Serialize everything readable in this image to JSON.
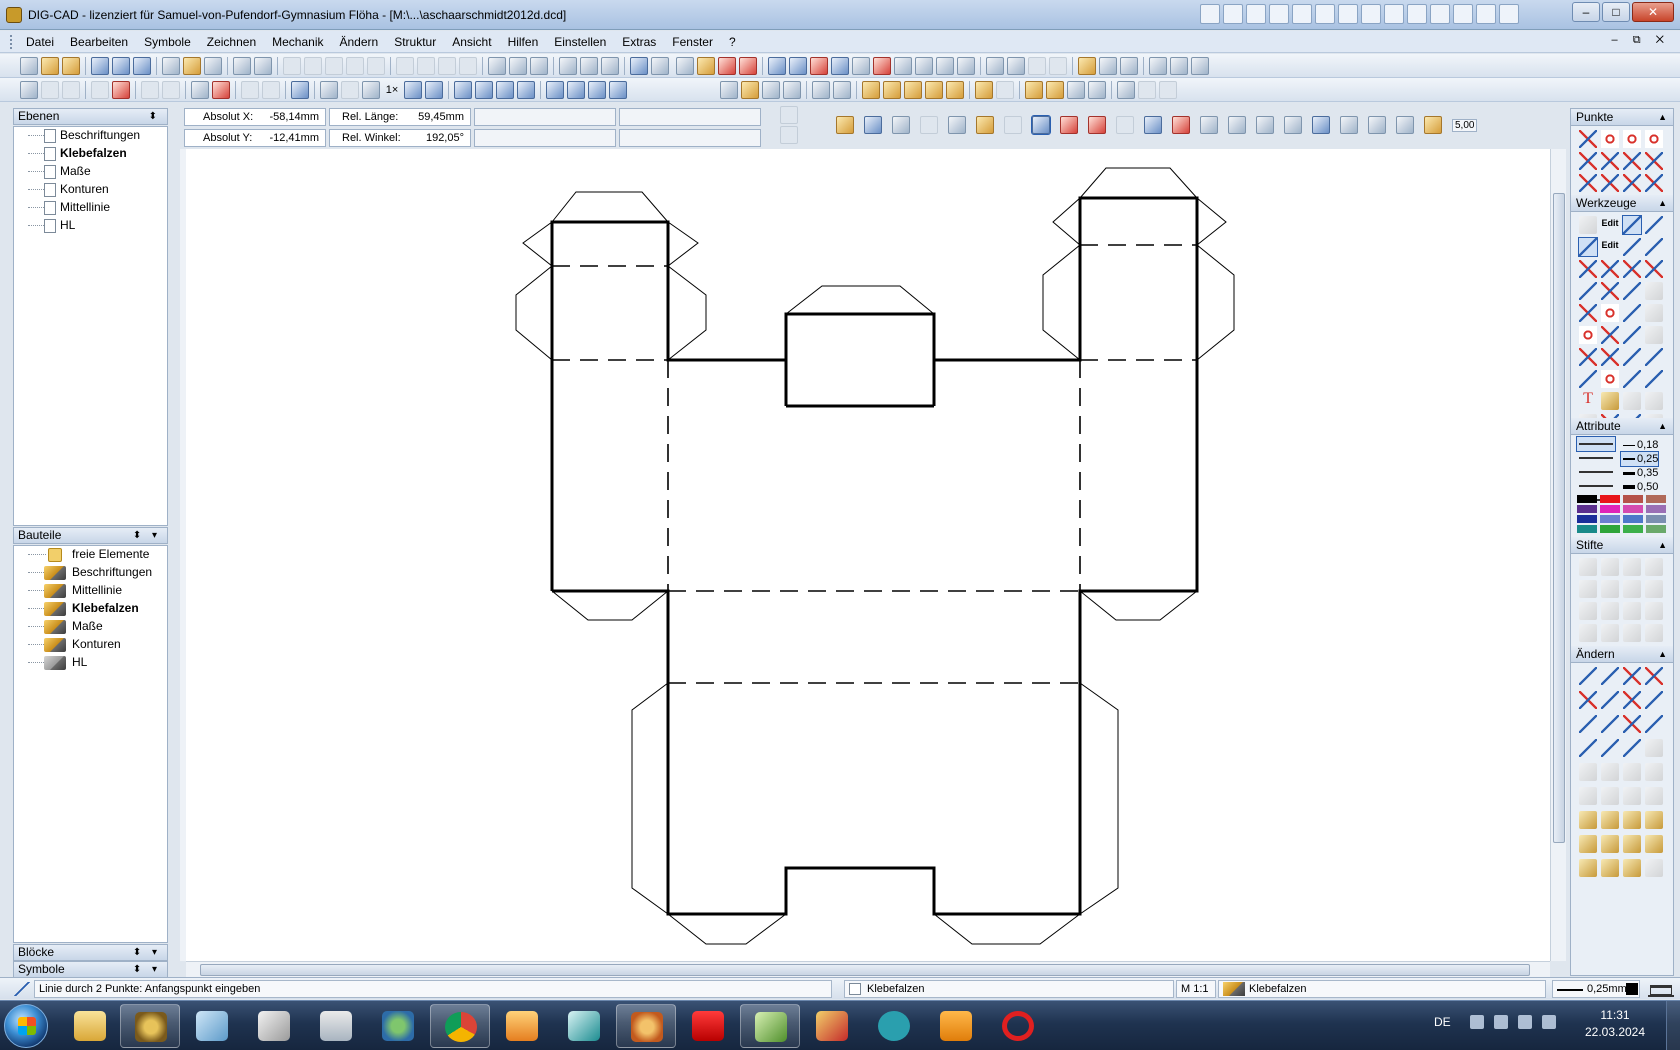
{
  "window": {
    "title": "DIG-CAD - lizenziert für Samuel-von-Pufendorf-Gymnasium Flöha - [M:\\...\\aschaarschmidt2012d.dcd]",
    "min": "–",
    "max": "□",
    "close": "✕"
  },
  "menu": [
    "Datei",
    "Bearbeiten",
    "Symbole",
    "Zeichnen",
    "Mechanik",
    "Ändern",
    "Struktur",
    "Ansicht",
    "Hilfen",
    "Einstellen",
    "Extras",
    "Fenster",
    "?"
  ],
  "mdi_controls": "– ⧉ ✕",
  "coords": {
    "abs_x_label": "Absolut X:",
    "abs_x_value": "-58,14mm",
    "abs_y_label": "Absolut Y:",
    "abs_y_value": "-12,41mm",
    "rel_len_label": "Rel. Länge:",
    "rel_len_value": "59,45mm",
    "rel_angle_label": "Rel. Winkel:",
    "rel_angle_value": "192,05°"
  },
  "toolbar_zoom_label": "1×",
  "snap_value": "5,00",
  "ebenen": {
    "title": "Ebenen",
    "items": [
      {
        "label": "Beschriftungen",
        "bold": false
      },
      {
        "label": "Klebefalzen",
        "bold": true
      },
      {
        "label": "Maße",
        "bold": false
      },
      {
        "label": "Konturen",
        "bold": false
      },
      {
        "label": "Mittellinie",
        "bold": false
      },
      {
        "label": "HL",
        "bold": false
      }
    ]
  },
  "bauteile": {
    "title": "Bauteile",
    "items": [
      {
        "label": "freie Elemente",
        "bold": false
      },
      {
        "label": "Beschriftungen",
        "bold": false
      },
      {
        "label": "Mittellinie",
        "bold": false
      },
      {
        "label": "Klebefalzen",
        "bold": true
      },
      {
        "label": "Maße",
        "bold": false
      },
      {
        "label": "Konturen",
        "bold": false
      },
      {
        "label": "HL",
        "bold": false
      }
    ]
  },
  "bloecke": {
    "title": "Blöcke"
  },
  "symbole": {
    "title": "Symbole"
  },
  "palette": {
    "punkte": "Punkte",
    "werkzeuge": "Werkzeuge",
    "attribute": "Attribute",
    "stifte": "Stifte",
    "aendern": "Ändern",
    "edit1": "Edit",
    "edit2": "Edit",
    "line_widths": [
      "0,18",
      "0,25",
      "0,35",
      "0,50"
    ],
    "colors": [
      "#000000",
      "#e8151b",
      "#b5524a",
      "#b06a5a",
      "#5a2e8e",
      "#e023b8",
      "#d44ab0",
      "#9a6fb5",
      "#1a2e9a",
      "#6c7fd0",
      "#4d78c9",
      "#7b8fb0",
      "#198a8a",
      "#2fa53a",
      "#3cb04a",
      "#6aa96a"
    ]
  },
  "status": {
    "prompt": "Linie durch 2 Punkte: Anfangspunkt eingeben",
    "layer": "Klebefalzen",
    "scale": "M 1:1",
    "part": "Klebefalzen",
    "pen": "0,25mm"
  },
  "taskbar": {
    "lang": "DE",
    "time": "11:31",
    "date": "22.03.2024"
  }
}
